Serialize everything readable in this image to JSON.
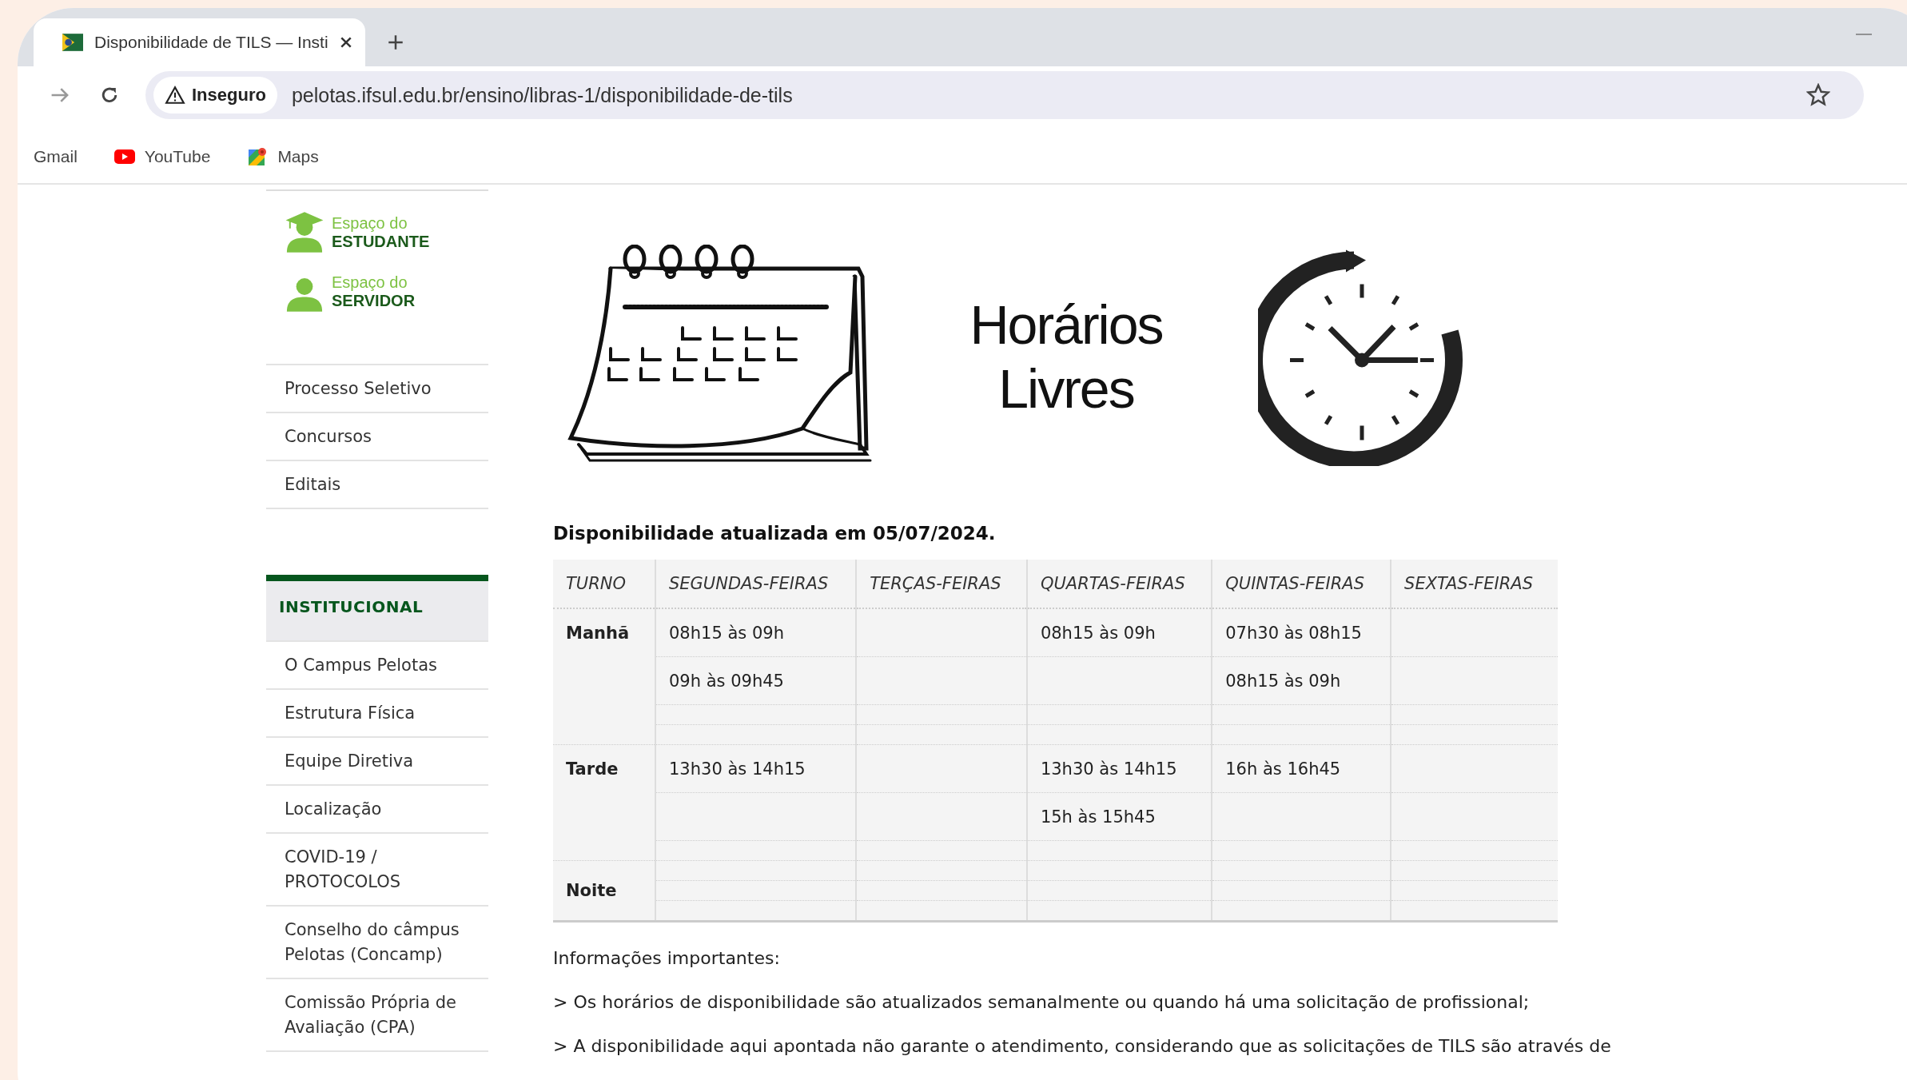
{
  "browser": {
    "tab": {
      "title": "Disponibilidade de TILS — Insti"
    },
    "address": {
      "security": "Inseguro",
      "url": "pelotas.ifsul.edu.br/ensino/libras-1/disponibilidade-de-tils"
    },
    "bookmarks": [
      {
        "label": "Gmail",
        "kind": "plain"
      },
      {
        "label": "YouTube",
        "kind": "youtube"
      },
      {
        "label": "Maps",
        "kind": "maps"
      }
    ]
  },
  "sidebar": {
    "spaces": [
      {
        "line1": "Espaço do",
        "line2": "ESTUDANTE",
        "kind": "student"
      },
      {
        "line1": "Espaço do",
        "line2": "SERVIDOR",
        "kind": "staff"
      }
    ],
    "links": [
      "Processo Seletivo",
      "Concursos",
      "Editais"
    ],
    "section": {
      "title": "INSTITUCIONAL",
      "items": [
        "O Campus Pelotas",
        "Estrutura Física",
        "Equipe Diretiva",
        "Localização",
        "COVID-19 / PROTOCOLOS",
        "Conselho do câmpus Pelotas (Concamp)",
        "Comissão Própria de Avaliação (CPA)"
      ]
    }
  },
  "banner": {
    "title_lines": [
      "Horários",
      "Livres"
    ]
  },
  "updated": "Disponibilidade atualizada em 05/07/2024.",
  "table": {
    "columns": [
      "TURNO",
      "SEGUNDAS-FEIRAS",
      "TERÇAS-FEIRAS",
      "QUARTAS-FEIRAS",
      "QUINTAS-FEIRAS",
      "SEXTAS-FEIRAS"
    ],
    "groups": [
      {
        "turno": "Manhã",
        "rows": [
          [
            "08h15 às 09h",
            null,
            "08h15 às 09h",
            "07h30 às 08h15",
            null
          ],
          [
            "09h às 09h45",
            null,
            null,
            "08h15 às 09h",
            null
          ],
          [
            null,
            null,
            null,
            null,
            null
          ],
          [
            null,
            null,
            null,
            null,
            null
          ]
        ]
      },
      {
        "turno": "Tarde",
        "rows": [
          [
            "13h30 às 14h15",
            null,
            "13h30 às 14h15",
            "16h às 16h45",
            null
          ],
          [
            null,
            null,
            "15h às 15h45",
            null,
            null
          ],
          [
            null,
            null,
            null,
            null,
            null
          ]
        ]
      },
      {
        "turno": "Noite",
        "rows": [
          [
            null,
            null,
            null,
            null,
            null
          ],
          [
            null,
            null,
            null,
            null,
            null
          ],
          [
            null,
            null,
            null,
            null,
            null
          ]
        ]
      }
    ]
  },
  "info": {
    "heading": "Informações importantes:",
    "paragraphs": [
      "> Os horários de disponibilidade são atualizados semanalmente ou quando há uma solicitação de profissional;",
      "> A disponibilidade aqui apontada não garante o atendimento, considerando que as solicitações de TILS são através de"
    ]
  }
}
